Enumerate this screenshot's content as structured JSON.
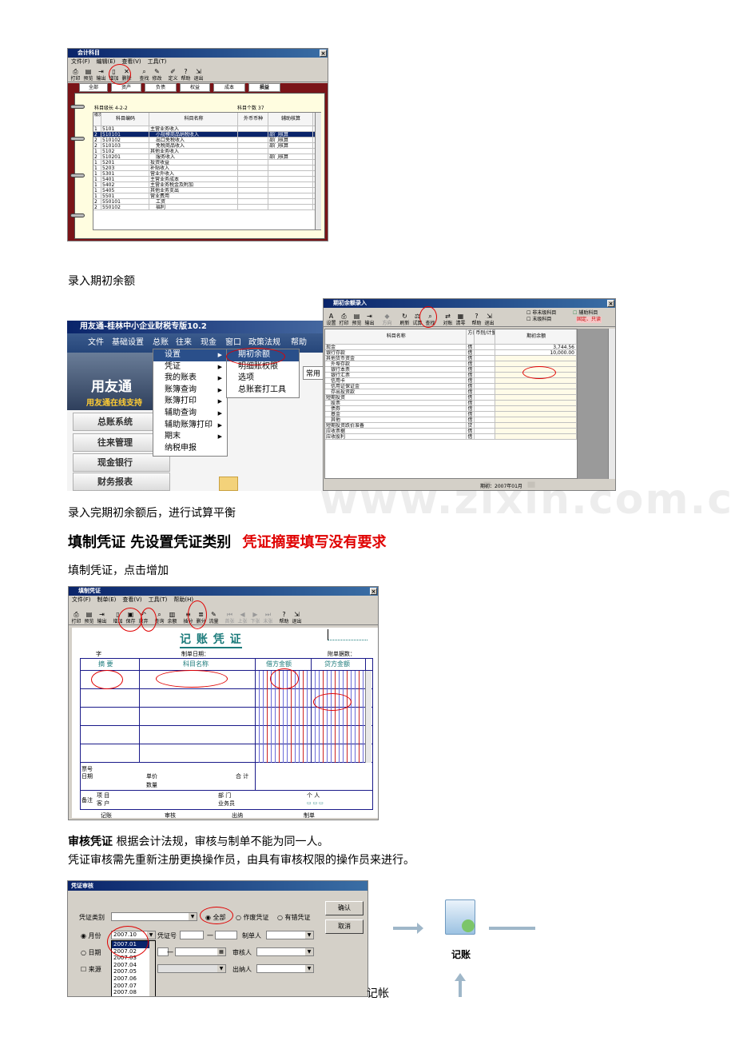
{
  "screen1": {
    "title": "会计科目",
    "menus": [
      "文件(F)",
      "编辑(E)",
      "查看(V)",
      "工具(T)"
    ],
    "toolbar": [
      "打印",
      "预览",
      "输出",
      "增加",
      "删除",
      "查找",
      "修改",
      "定义",
      "帮助",
      "退出"
    ],
    "tabs": [
      "全部",
      "资产",
      "负债",
      "权益",
      "成本",
      "损益"
    ],
    "level_label": "科目级长  4-2-2",
    "count_label": "科目个数  37",
    "headers": [
      "级次",
      "科目编码",
      "科目名称",
      "外币币种",
      "辅助核算"
    ],
    "rows": [
      [
        "1",
        "5101",
        "主营业务收入",
        "",
        ""
      ],
      [
        "2",
        "510101",
        "小规模商品纳税收入",
        "",
        "部门核算"
      ],
      [
        "2",
        "510102",
        "出口免税收入",
        "",
        "部门核算"
      ],
      [
        "2",
        "510103",
        "免税商品收入",
        "",
        "部门核算"
      ],
      [
        "1",
        "5102",
        "其他业务收入",
        "",
        ""
      ],
      [
        "2",
        "510201",
        "服务收入",
        "",
        "部门核算"
      ],
      [
        "1",
        "5201",
        "投资收益",
        "",
        ""
      ],
      [
        "1",
        "5203",
        "补贴收入",
        "",
        ""
      ],
      [
        "1",
        "5301",
        "营业外收入",
        "",
        ""
      ],
      [
        "1",
        "5401",
        "主营业务成本",
        "",
        ""
      ],
      [
        "1",
        "5402",
        "主营业务税金及附加",
        "",
        ""
      ],
      [
        "1",
        "5405",
        "其他业务支出",
        "",
        ""
      ],
      [
        "1",
        "5501",
        "营业费用",
        "",
        ""
      ],
      [
        "2",
        "550101",
        "工资",
        "",
        ""
      ],
      [
        "2",
        "550102",
        "福利",
        "",
        ""
      ]
    ]
  },
  "caption1": "录入期初余额",
  "screen2": {
    "app_title": "用友通-桂林中小企业财税专版10.2",
    "menus": [
      "文件",
      "基础设置",
      "总账",
      "往来",
      "现金",
      "窗口",
      "政策法规",
      "帮助"
    ],
    "logo": "用友通",
    "slogan": "用友通在线支持",
    "nav": [
      "总账系统",
      "往来管理",
      "现金银行",
      "财务报表"
    ],
    "submenu": [
      "设置",
      "凭证",
      "我的账表",
      "账簿查询",
      "账簿打印",
      "辅助查询",
      "辅助账簿打印",
      "期末",
      "纳税申报"
    ],
    "submenu2": [
      "期初余额",
      "明细账权限",
      "选项",
      "总账套打工具"
    ],
    "common": "常用"
  },
  "screen3": {
    "title": "期初余额录入",
    "toolbar": [
      "设置",
      "打印",
      "预览",
      "输出",
      "方向",
      "刷新",
      "试算",
      "查找",
      "对账",
      "清零",
      "帮助",
      "退出"
    ],
    "legend": [
      "非末级科目",
      "末级科目",
      "辅助科目"
    ],
    "legend_note": "固定、只读",
    "headers": [
      "科目名称",
      "方向",
      "币别/计量",
      "期初余额"
    ],
    "rows": [
      [
        "现金",
        "借",
        "",
        "3,744.56"
      ],
      [
        "银行存款",
        "借",
        "",
        "10,000.00"
      ],
      [
        "其他货币资金",
        "借",
        "",
        ""
      ],
      [
        "外埠存款",
        "借",
        "",
        ""
      ],
      [
        "银行本票",
        "借",
        "",
        ""
      ],
      [
        "银行汇票",
        "借",
        "",
        ""
      ],
      [
        "信用卡",
        "借",
        "",
        ""
      ],
      [
        "信用证保证金",
        "借",
        "",
        ""
      ],
      [
        "存出投资款",
        "借",
        "",
        ""
      ],
      [
        "短期投资",
        "借",
        "",
        ""
      ],
      [
        "股票",
        "借",
        "",
        ""
      ],
      [
        "债券",
        "借",
        "",
        ""
      ],
      [
        "基金",
        "借",
        "",
        ""
      ],
      [
        "其他",
        "借",
        "",
        ""
      ],
      [
        "短期投资跌价准备",
        "贷",
        "",
        ""
      ],
      [
        "应收票据",
        "借",
        "",
        ""
      ],
      [
        "应收股利",
        "借",
        "",
        ""
      ]
    ],
    "status": "期初：2007年01月"
  },
  "caption2": "录入完期初余额后，进行试算平衡",
  "heading": {
    "black": "填制凭证  先设置凭证类别",
    "red": "凭证摘要填写没有要求"
  },
  "caption3": "填制凭证，点击增加",
  "screen4": {
    "title": "填制凭证",
    "menus": [
      "文件(F)",
      "制单(E)",
      "查看(V)",
      "工具(T)",
      "帮助(H)"
    ],
    "toolbar": [
      "打印",
      "预览",
      "输出",
      "增加",
      "保存",
      "放弃",
      "查询",
      "余额",
      "插分",
      "删分",
      "流量",
      "首张",
      "上张",
      "下张",
      "末张",
      "帮助",
      "退出"
    ],
    "voucher_title": "记 账 凭 证",
    "zi": "字",
    "date_label": "制单日期：",
    "attach_label": "附单据数：",
    "headers": [
      "摘 要",
      "科目名称",
      "借方金额",
      "贷方金额"
    ],
    "ticket": "票号",
    "date": "日期",
    "price": "单价",
    "qty": "数量",
    "total": "合 计",
    "remark": "备注",
    "project": "项  目",
    "dept": "部  门",
    "person": "个  人",
    "customer": "客  户",
    "salesman": "业务员",
    "footer": [
      "记账",
      "审核",
      "出纳",
      "制单"
    ]
  },
  "para1": {
    "bold": "审核凭证",
    "text": " 根据会计法规，审核与制单不能为同一人。"
  },
  "para2": "凭证审核需先重新注册更换操作员，由具有审核权限的操作员来进行。",
  "screen5": {
    "title": "凭证审核",
    "type_label": "凭证类别",
    "radio_all": "全部",
    "radio_void": "作废凭证",
    "radio_err": "有错凭证",
    "month_label": "月份",
    "month_value": "2007.10",
    "voucher_no": "凭证号",
    "dash": "一",
    "maker": "制单人",
    "date_label": "日期",
    "auditor": "审核人",
    "source": "来源",
    "cashier": "出纳人",
    "ok": "确认",
    "cancel": "取消",
    "months": [
      "2007.01",
      "2007.02",
      "2007.03",
      "2007.04",
      "2007.05",
      "2007.06",
      "2007.07",
      "2007.08"
    ]
  },
  "jizhang_label": "记账",
  "jizhang_text": "记帐"
}
